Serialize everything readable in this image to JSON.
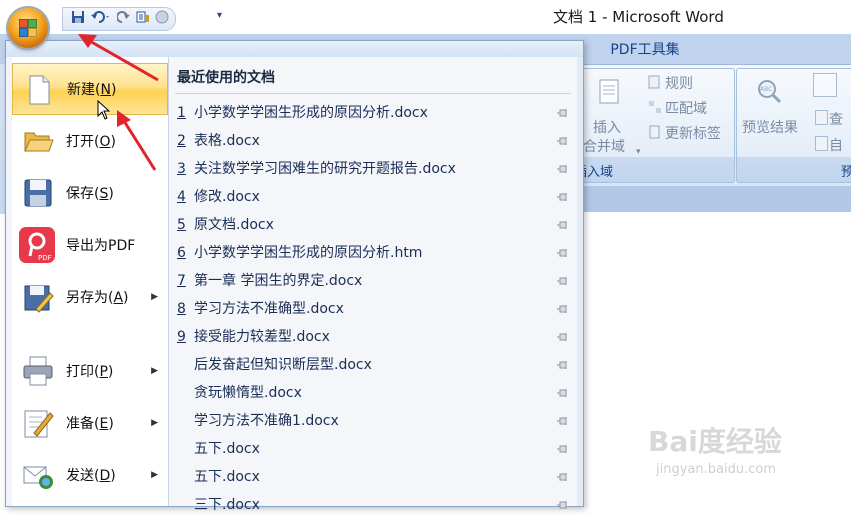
{
  "window": {
    "title": "文档 1 - Microsoft Word"
  },
  "ribbon": {
    "tab_pdf": "PDF工具集",
    "group_insert_field": {
      "insert_btn_line1": "插入",
      "insert_btn_line2": "合并域",
      "rules": "规则",
      "match_fields": "匹配域",
      "update_labels": "更新标签",
      "label": "插入域"
    },
    "group_preview": {
      "preview_results": "预览结果",
      "search": "查",
      "auto": "自",
      "label": "预"
    }
  },
  "menu": {
    "left_items": [
      {
        "label": "新建",
        "key": "N",
        "icon": "new-document-icon",
        "has_arrow": false
      },
      {
        "label": "打开",
        "key": "O",
        "icon": "open-folder-icon",
        "has_arrow": false
      },
      {
        "label": "保存",
        "key": "S",
        "icon": "save-floppy-icon",
        "has_arrow": false
      },
      {
        "label": "导出为PDF",
        "key": "",
        "icon": "pdf-export-icon",
        "has_arrow": false
      },
      {
        "label": "另存为",
        "key": "A",
        "icon": "save-as-icon",
        "has_arrow": true
      },
      {
        "label": "打印",
        "key": "P",
        "icon": "printer-icon",
        "has_arrow": true
      },
      {
        "label": "准备",
        "key": "E",
        "icon": "prepare-icon",
        "has_arrow": true
      },
      {
        "label": "发送",
        "key": "D",
        "icon": "send-icon",
        "has_arrow": true
      }
    ],
    "recent_title": "最近使用的文档",
    "recent_docs": [
      {
        "num": "1",
        "name": "小学数学学困生形成的原因分析.docx"
      },
      {
        "num": "2",
        "name": "表格.docx"
      },
      {
        "num": "3",
        "name": "关注数学学习困难生的研究开题报告.docx"
      },
      {
        "num": "4",
        "name": "修改.docx"
      },
      {
        "num": "5",
        "name": "原文档.docx"
      },
      {
        "num": "6",
        "name": "小学数学学困生形成的原因分析.htm"
      },
      {
        "num": "7",
        "name": "第一章 学困生的界定.docx"
      },
      {
        "num": "8",
        "name": "学习方法不准确型.docx"
      },
      {
        "num": "9",
        "name": "接受能力较差型.docx"
      },
      {
        "num": "",
        "name": "后发奋起但知识断层型.docx"
      },
      {
        "num": "",
        "name": "贪玩懒惰型.docx"
      },
      {
        "num": "",
        "name": "学习方法不准确1.docx"
      },
      {
        "num": "",
        "name": "五下.docx"
      },
      {
        "num": "",
        "name": "五下.docx"
      },
      {
        "num": "",
        "name": "三下.docx"
      }
    ]
  },
  "watermark": {
    "main": "Bai度经验",
    "sub": "jingyan.baidu.com"
  },
  "colors": {
    "accent_arrow": "#e0252b",
    "menu_highlight": "#ffd152",
    "ribbon_blue": "#c7daf1"
  }
}
